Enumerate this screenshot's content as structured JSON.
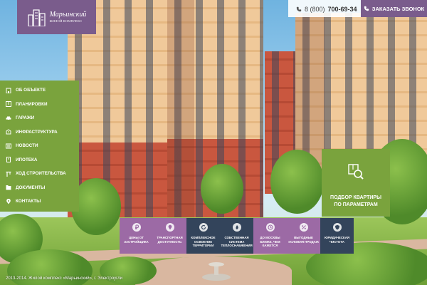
{
  "logo": {
    "title": "Марьинский",
    "subtitle": "ЖИЛОЙ КОМПЛЕКС"
  },
  "header": {
    "phone_prefix": "8 (800)",
    "phone_number": "700-69-34",
    "callback_label": "ЗАКАЗАТЬ ЗВОНОК"
  },
  "nav": {
    "items": [
      {
        "label": "ОБ ОБЪЕКТЕ",
        "icon": "building-icon"
      },
      {
        "label": "ПЛАНИРОВКИ",
        "icon": "floorplan-icon"
      },
      {
        "label": "ГАРАЖИ",
        "icon": "car-icon"
      },
      {
        "label": "ИНФРАСТРУКТУРА",
        "icon": "infrastructure-icon"
      },
      {
        "label": "НОВОСТИ",
        "icon": "news-icon"
      },
      {
        "label": "ИПОТЕКА",
        "icon": "mortgage-icon"
      },
      {
        "label": "ХОД СТРОИТЕЛЬСТВА",
        "icon": "crane-icon"
      },
      {
        "label": "ДОКУМЕНТЫ",
        "icon": "documents-icon"
      },
      {
        "label": "КОНТАКТЫ",
        "icon": "pin-icon"
      }
    ]
  },
  "search": {
    "label": "ПОДБОР КВАРТИРЫ ПО ПАРАМЕТРАМ"
  },
  "features": [
    {
      "label": "ЦЕНЫ ОТ ЗАСТРОЙЩИКА",
      "icon": "ruble-icon",
      "color": "purple"
    },
    {
      "label": "ТРАНСПОРТНАЯ ДОСТУПНОСТЬ",
      "icon": "location-icon",
      "color": "purple"
    },
    {
      "label": "КОМПЛЕКСНОЕ ОСВОЕНИЕ ТЕРРИТОРИИ",
      "icon": "refresh-icon",
      "color": "navy"
    },
    {
      "label": "СОБСТВЕННАЯ СИСТЕМА ТЕПЛОСНАБЖЕНИЯ",
      "icon": "heat-icon",
      "color": "navy"
    },
    {
      "label": "ДО МОСКВЫ БЛИЖЕ, ЧЕМ КАЖЕТСЯ",
      "icon": "clock-icon",
      "color": "purple"
    },
    {
      "label": "ВЫГОДНЫЕ УСЛОВИЯ ПРОДАЖ",
      "icon": "percent-icon",
      "color": "purple"
    },
    {
      "label": "ЮРИДИЧЕСКАЯ ЧИСТОТА",
      "icon": "shield-icon",
      "color": "navy"
    }
  ],
  "footer": {
    "copyright": "2013-2014. Жилой комплекс «Марьинский», г. Электроугли"
  },
  "colors": {
    "purple": "#7a5c8c",
    "feature_purple": "#9c6aa5",
    "navy": "#33445b",
    "green": "#7aa33d"
  }
}
